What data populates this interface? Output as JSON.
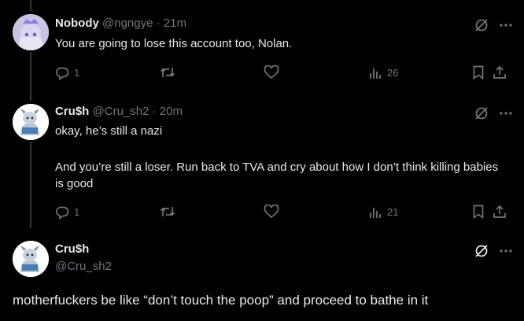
{
  "tweets": [
    {
      "name": "Nobody",
      "handle": "@ngngye",
      "sep": "·",
      "time": "21m",
      "text": "You are going to lose this account too, Nolan.",
      "replies": "1",
      "views": "26"
    },
    {
      "name": "Cru$h",
      "handle": "@Cru_sh2",
      "sep": "·",
      "time": "20m",
      "text_line1": "okay, he’s still a nazi",
      "text_line2": "And you’re still a loser. Run back to TVA and cry about how I don’t think killing babies is good",
      "replies": "1",
      "views": "21"
    }
  ],
  "main": {
    "name": "Cru$h",
    "handle": "@Cru_sh2",
    "text": "motherfuckers be like “don’t touch the poop” and proceed to bathe in it"
  },
  "icons": [
    "grok-icon",
    "more-icon",
    "reply-icon",
    "retweet-icon",
    "like-icon",
    "views-icon",
    "bookmark-icon",
    "share-icon"
  ],
  "colors": {
    "background": "#000000",
    "text": "#e7e9ea",
    "muted": "#71767b",
    "line": "#333639"
  }
}
